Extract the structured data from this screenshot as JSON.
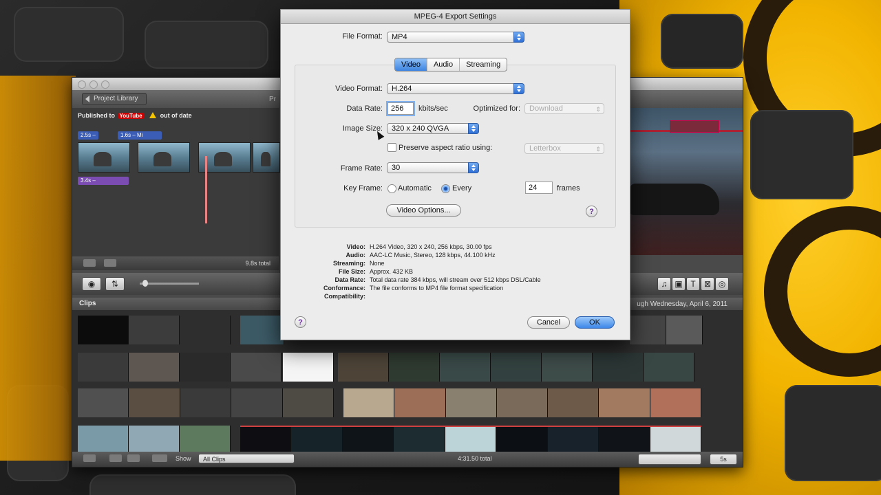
{
  "dialog": {
    "title": "MPEG-4 Export Settings",
    "file_format_label": "File Format:",
    "file_format_value": "MP4",
    "tabs": [
      {
        "label": "Video",
        "selected": true
      },
      {
        "label": "Audio",
        "selected": false
      },
      {
        "label": "Streaming",
        "selected": false
      }
    ],
    "video_format_label": "Video Format:",
    "video_format_value": "H.264",
    "data_rate_label": "Data Rate:",
    "data_rate_value": "256",
    "data_rate_unit": "kbits/sec",
    "optimized_for_label": "Optimized for:",
    "optimized_for_value": "Download",
    "image_size_label": "Image Size:",
    "image_size_value": "320 x 240 QVGA",
    "preserve_aspect_label": "Preserve aspect ratio using:",
    "preserve_aspect_checked": false,
    "preserve_aspect_value": "Letterbox",
    "frame_rate_label": "Frame Rate:",
    "frame_rate_value": "30",
    "key_frame_label": "Key Frame:",
    "key_frame_automatic": "Automatic",
    "key_frame_every": "Every",
    "key_frame_selected": "Every",
    "key_frame_interval": "24",
    "key_frame_unit": "frames",
    "video_options_button": "Video Options...",
    "summary": [
      {
        "label": "Video:",
        "value": "H.264 Video, 320 x 240, 256 kbps, 30.00 fps"
      },
      {
        "label": "Audio:",
        "value": "AAC-LC Music, Stereo, 128 kbps, 44.100 kHz"
      },
      {
        "label": "Streaming:",
        "value": "None"
      },
      {
        "label": "File Size:",
        "value": "Approx. 432 KB"
      },
      {
        "label": "Data Rate:",
        "value": "Total data rate 384 kbps, will stream over 512 kbps DSL/Cable"
      },
      {
        "label": "Conformance:",
        "value": "The file conforms to MP4 file format specification"
      },
      {
        "label": "Compatibility:",
        "value": ""
      }
    ],
    "help_glyph": "?",
    "cancel_button": "Cancel",
    "ok_button": "OK"
  },
  "imovie": {
    "project_library_button": "Project Library",
    "project_title_fragment": "Pr",
    "published_text": "Published to",
    "published_service": "YouTube",
    "out_of_date": "out of date",
    "clip_tags": [
      "2.5s –",
      "1.6s – Mi",
      "3.4s –"
    ],
    "project_total": "9.8s total",
    "clips_label": "Clips",
    "clips_date_fragment": "ugh Wednesday, April 6, 2011",
    "show_label": "Show",
    "show_value": "All Clips",
    "clips_total": "4:31.50 total",
    "zoom_value": "5s",
    "tool_icons": [
      "camera-import-icon",
      "swap-icon",
      "music-icon",
      "photo-icon",
      "title-icon",
      "transition-icon",
      "map-icon"
    ]
  },
  "colors": {
    "accent_blue": "#3e84e0",
    "help_purple": "#6a2f9c",
    "wallpaper_yellow": "#f2b400",
    "playhead_pink": "#e98383"
  }
}
